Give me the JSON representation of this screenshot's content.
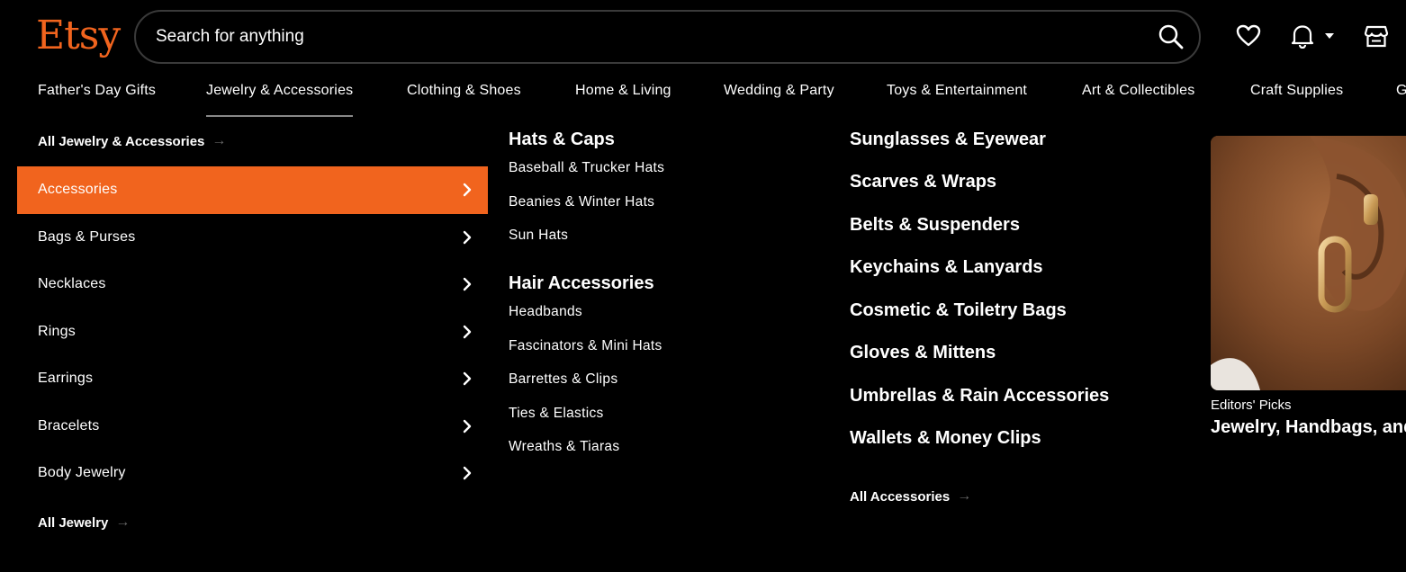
{
  "header": {
    "logo": "Etsy",
    "search_placeholder": "Search for anything",
    "colors": {
      "brand": "#F1641E",
      "background": "#000000",
      "text": "#FFFFFF"
    }
  },
  "categories": [
    "Father's Day Gifts",
    "Jewelry & Accessories",
    "Clothing & Shoes",
    "Home & Living",
    "Wedding & Party",
    "Toys & Entertainment",
    "Art & Collectibles",
    "Craft Supplies",
    "G"
  ],
  "active_category": "Jewelry & Accessories",
  "left": {
    "all_top": "All Jewelry & Accessories",
    "items": [
      "Accessories",
      "Bags & Purses",
      "Necklaces",
      "Rings",
      "Earrings",
      "Bracelets",
      "Body Jewelry"
    ],
    "active_item": "Accessories",
    "all_bottom": "All Jewelry"
  },
  "middle": {
    "groups": [
      {
        "title": "Hats & Caps",
        "links": [
          "Baseball & Trucker Hats",
          "Beanies & Winter Hats",
          "Sun Hats"
        ]
      },
      {
        "title": "Hair Accessories",
        "links": [
          "Headbands",
          "Fascinators & Mini Hats",
          "Barrettes & Clips",
          "Ties & Elastics",
          "Wreaths & Tiaras"
        ]
      }
    ]
  },
  "right": {
    "links": [
      "Sunglasses & Eyewear",
      "Scarves & Wraps",
      "Belts & Suspenders",
      "Keychains & Lanyards",
      "Cosmetic & Toiletry Bags",
      "Gloves & Mittens",
      "Umbrellas & Rain Accessories",
      "Wallets & Money Clips"
    ],
    "all_link": "All Accessories"
  },
  "editors_picks": {
    "label": "Editors' Picks",
    "title": "Jewelry, Handbags, and"
  },
  "icons": [
    "search-icon",
    "heart-icon",
    "bell-icon",
    "caret-down-icon",
    "shop-icon",
    "chevron-right-icon",
    "arrow-right-icon"
  ]
}
